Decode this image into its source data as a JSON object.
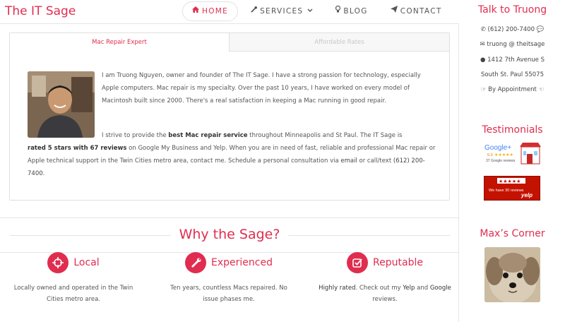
{
  "header": {
    "logo": "The IT Sage",
    "nav": [
      {
        "label": "HOME",
        "icon": "home-icon"
      },
      {
        "label": "SERVICES",
        "icon": "wrench-icon"
      },
      {
        "label": "BLOG",
        "icon": "lightbulb-icon"
      },
      {
        "label": "CONTACT",
        "icon": "paper-plane-icon"
      }
    ]
  },
  "tabs": {
    "active": "Mac Repair Expert",
    "inactive": "Affordable Rates"
  },
  "about": {
    "p1": "I am Truong Nguyen, owner and founder of The IT Sage. I have a strong passion for technology, especially Apple computers. Mac repair is my specialty. Over the past 10 years, I have worked on every model of Macintosh built since 2000. There's a real satisfaction in keeping a Mac running in good repair.",
    "p2_lead": "I strive to provide the ",
    "p2_bold1": "best Mac repair service",
    "p2_mid1": " throughout Minneapolis and St Paul. The IT Sage is ",
    "p2_bold2": "rated 5 stars with 67 reviews",
    "p2_mid2": " on Google My Business and Yelp. When you are in need of fast, reliable and professional Mac repair or Apple technical support in the Twin Cities metro area, contact me. Schedule a personal consultation via ",
    "p2_email": "email",
    "p2_mid3": " or call/text ",
    "p2_phone": "(612) 200-7400",
    "p2_end": "."
  },
  "why": {
    "title": "Why the Sage?"
  },
  "features": [
    {
      "title": "Local",
      "icon": "crosshairs-icon",
      "text": "Locally owned and operated in the Twin Cities metro area."
    },
    {
      "title": "Experienced",
      "icon": "wrench-icon",
      "text": "Ten years, countless Macs repaired. No issue phases me."
    },
    {
      "title": "Reputable",
      "icon": "check-square-icon",
      "text_lead": "Highly rated",
      "text_mid": ". Check out my ",
      "text_yelp": "Yelp",
      "text_and": " and ",
      "text_google": "Google",
      "text_end": " reviews."
    }
  ],
  "sidebar": {
    "talk_title": "Talk to Truong",
    "phone": "(612) 200-7400",
    "email": "truong @ theitsage",
    "address1": "1412 7th Avenue S",
    "address2": "South St. Paul 55075",
    "appointment": "By Appointment",
    "testimonials_title": "Testimonials",
    "google_badge": {
      "brand": "Google+",
      "rating": "5.0",
      "reviews": "37 Google reviews"
    },
    "yelp_badge": {
      "text": "We have 30 reviews",
      "brand": "yelp"
    },
    "max_title": "Max’s Corner"
  },
  "colors": {
    "accent": "#e02d4f",
    "text": "#555555",
    "border": "#e0e0e0"
  }
}
